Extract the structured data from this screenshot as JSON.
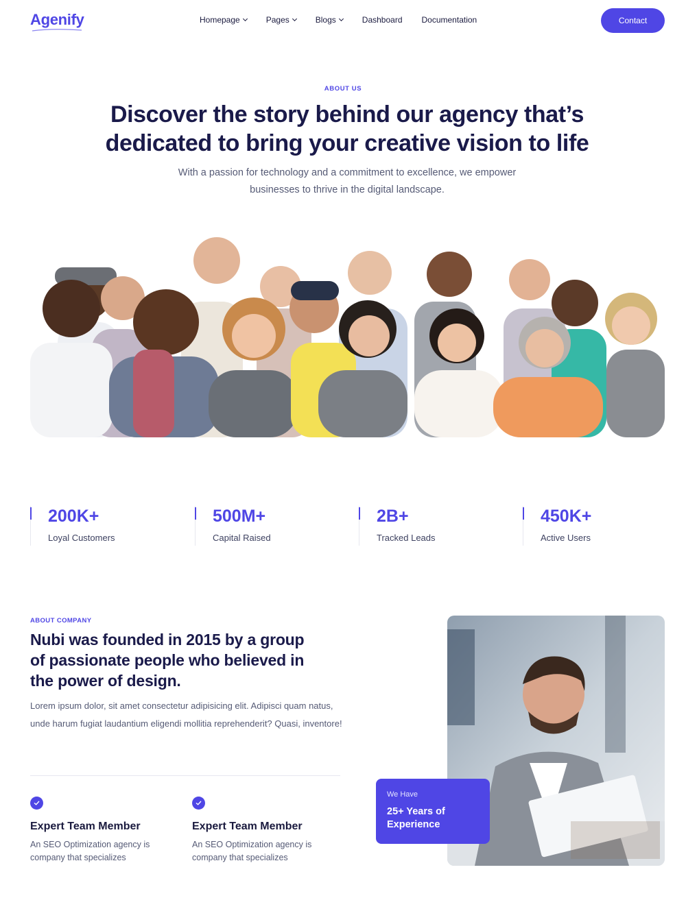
{
  "brand": {
    "name": "Agenify",
    "color": "#4f46e5"
  },
  "nav": {
    "items": [
      {
        "label": "Homepage",
        "dropdown": true
      },
      {
        "label": "Pages",
        "dropdown": true
      },
      {
        "label": "Blogs",
        "dropdown": true
      },
      {
        "label": "Dashboard",
        "dropdown": false
      },
      {
        "label": "Documentation",
        "dropdown": false
      }
    ],
    "contact_label": "Contact"
  },
  "hero": {
    "eyebrow": "ABOUT US",
    "title": "Discover the story behind our agency that’s dedicated to bring your creative vision to life",
    "subtitle": "With a passion for technology and a commitment to excellence, we empower businesses to thrive in the digital landscape."
  },
  "stats": [
    {
      "value": "200K+",
      "label": "Loyal Customers"
    },
    {
      "value": "500M+",
      "label": "Capital Raised"
    },
    {
      "value": "2B+",
      "label": "Tracked Leads"
    },
    {
      "value": "450K+",
      "label": "Active Users"
    }
  ],
  "about": {
    "eyebrow": "ABOUT COMPANY",
    "title": "Nubi was founded in 2015 by a group of passionate people who believed in the power of design.",
    "body": "Lorem ipsum dolor, sit amet consectetur adipisicing elit. Adipisci quam natus, unde harum fugiat laudantium eligendi mollitia reprehenderit? Quasi, inventore!",
    "features": [
      {
        "title": "Expert Team Member",
        "body": "An SEO Optimization agency is company that specializes",
        "icon": "check-icon"
      },
      {
        "title": "Expert Team Member",
        "body": "An SEO Optimization agency is company that specializes",
        "icon": "check-icon"
      }
    ],
    "experience": {
      "small": "We Have",
      "big": "25+ Years of Experience"
    }
  }
}
